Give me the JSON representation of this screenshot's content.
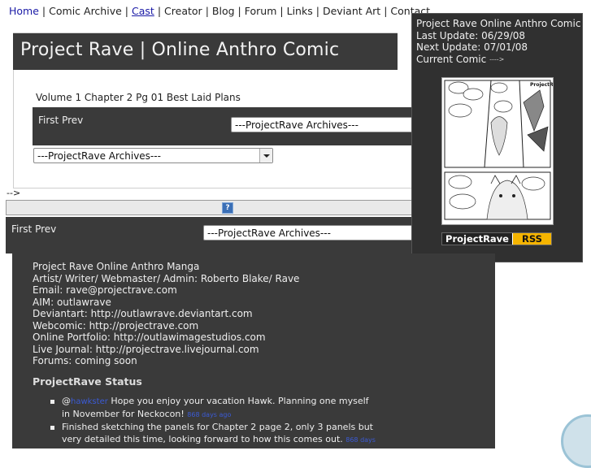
{
  "topnav": {
    "home": "Home",
    "comic_archive": "Comic Archive",
    "cast": "Cast",
    "creator": "Creator",
    "blog": "Blog",
    "forum": "Forum",
    "links": "Links",
    "deviant_art": "Deviant Art",
    "contact": "Contact",
    "separator": "|"
  },
  "header": {
    "title": "Project Rave | Online Anthro Comic"
  },
  "comic": {
    "caption": "Volume 1 Chapter 2 Pg 01 Best Laid Plans",
    "first_prev": "First Prev",
    "archives_select": "---ProjectRave Archives---"
  },
  "misc": {
    "stray_arrow": "-->",
    "help_icon_glyph": "?"
  },
  "sidebar": {
    "line1": "Project Rave Online Anthro Comic",
    "last_update": "Last Update: 06/29/08",
    "next_update": "Next Update: 07/01/08",
    "current_comic": "Current Comic",
    "current_arrow": "---->",
    "badge_left": "ProjectRave",
    "badge_right": "RSS"
  },
  "about": {
    "lines": [
      "Project Rave Online Anthro Manga",
      "Artist/ Writer/ Webmaster/ Admin: Roberto Blake/ Rave",
      "Email: rave@projectrave.com",
      "AIM: outlawrave",
      "Deviantart: http://outlawrave.deviantart.com",
      "Webcomic: http://projectrave.com",
      "Online Portfolio: http://outlawimagestudios.com",
      "Live Journal: http://projectrave.livejournal.com",
      "Forums: coming soon"
    ]
  },
  "status": {
    "title": "ProjectRave Status",
    "items": [
      {
        "prefix": "@",
        "mention": "hawkster",
        "text": " Hope you enjoy your vacation Hawk. Planning one myself in November for Neckocon! ",
        "time": "868 days ago"
      },
      {
        "prefix": "",
        "mention": "",
        "text": "Finished sketching the panels for Chapter 2 page 2, only 3 panels but very detailed this time, looking forward to how this comes out. ",
        "time": "868 days"
      }
    ]
  },
  "colors": {
    "dark_panel": "#3a3a3a",
    "link_blue": "#1a1aa6",
    "rss_orange": "#f5b400"
  }
}
